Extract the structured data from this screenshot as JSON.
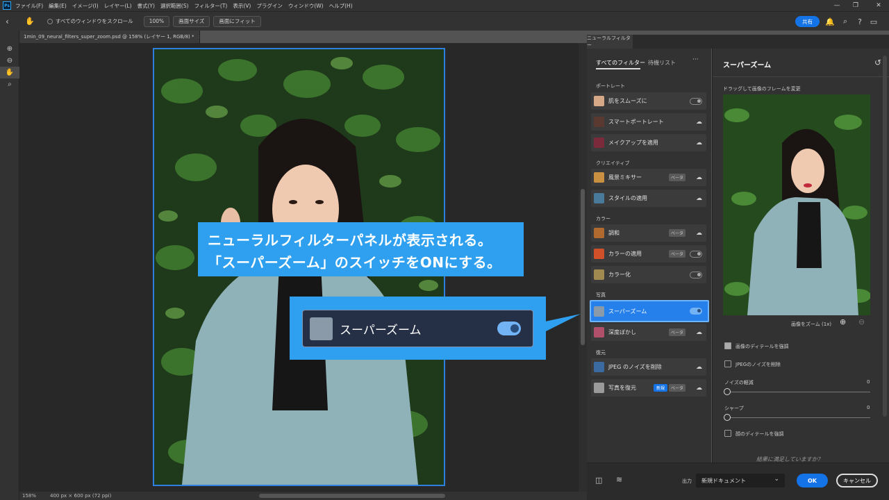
{
  "menubar": {
    "app_icon": "Ps",
    "items": [
      "ファイル(F)",
      "編集(E)",
      "イメージ(I)",
      "レイヤー(L)",
      "書式(Y)",
      "選択範囲(S)",
      "フィルター(T)",
      "表示(V)",
      "プラグイン",
      "ウィンドウ(W)",
      "ヘルプ(H)"
    ]
  },
  "options": {
    "scroll_all_label": "すべてのウィンドウをスクロール",
    "zoom_100": "100%",
    "fit_screen": "画面サイズ",
    "fill_screen": "画面にフィット",
    "share": "共有"
  },
  "document": {
    "tab_title": "1min_09_neural_filters_super_zoom.psd @ 158% (レイヤー 1, RGB/8) *",
    "status_zoom": "158%",
    "status_info": "400 px × 600 px (72 ppi)"
  },
  "neural": {
    "panel_title": "ニューラルフィルター",
    "tab_all": "すべてのフィルター",
    "tab_waitlist": "待機リスト",
    "more": "···",
    "categories": {
      "portrait": "ポートレート",
      "creative": "クリエイティブ",
      "color": "カラー",
      "photo": "写真",
      "restore": "復元"
    },
    "filters": {
      "smooth_skin": "肌をスムーズに",
      "smart_portrait": "スマートポートレート",
      "makeup": "メイクアップを適用",
      "landscape": "風景ミキサー",
      "style": "スタイルの適用",
      "harmonize": "調和",
      "color_transfer": "カラーの適用",
      "colorize": "カラー化",
      "super_zoom": "スーパーズーム",
      "depth_blur": "深度ぼかし",
      "jpeg": "JPEG のノイズを削除",
      "photo_restore": "写真を復元"
    },
    "badge_beta": "ベータ",
    "badge_new": "新規",
    "detail": {
      "title": "スーパーズーム",
      "drag_hint": "ドラッグして画像のフレームを変更",
      "zoom_label": "画像をズーム (1x)",
      "enhance_detail": "画像のディテールを強調",
      "remove_jpeg": "JPEGのノイズを削除",
      "noise_label": "ノイズの軽減",
      "noise_value": "0",
      "sharpen_label": "シャープ",
      "sharpen_value": "0",
      "face_detail": "顔のディテールを強調",
      "feedback": "結果に満足していますか？"
    },
    "output_label": "出力",
    "output_value": "新規ドキュメント",
    "ok": "OK",
    "cancel": "キャンセル"
  },
  "callout": {
    "line1": "ニューラルフィルターパネルが表示される。",
    "line2": "「スーパーズーム」のスイッチをONにする。",
    "zoom_label": "スーパーズーム"
  },
  "colors": {
    "accent": "#2680eb",
    "callout": "#2ea0ef",
    "panel": "#323232"
  }
}
